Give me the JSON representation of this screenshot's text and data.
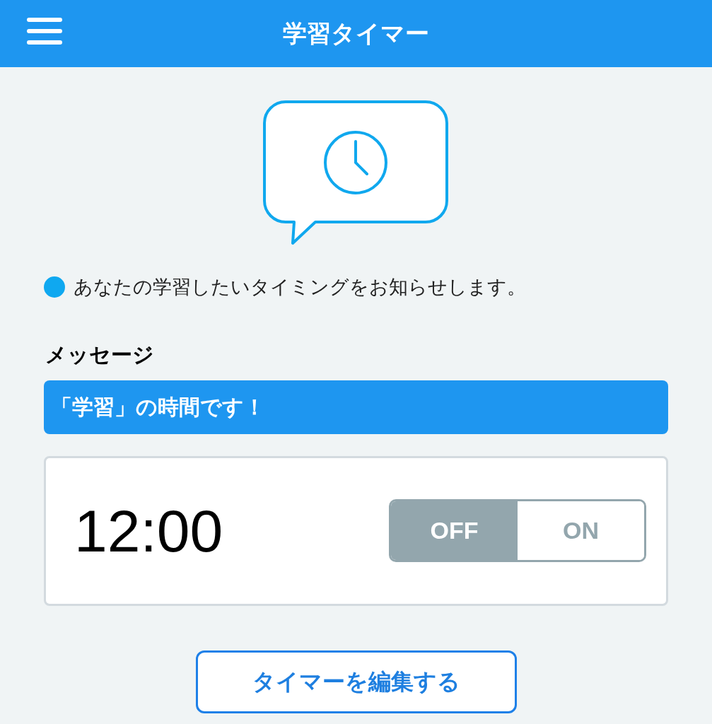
{
  "header": {
    "title": "学習タイマー"
  },
  "info": {
    "text": "あなたの学習したいタイミングをお知らせします。",
    "color": "#0fa8f0"
  },
  "message": {
    "label": "メッセージ",
    "text": "「学習」の時間です！"
  },
  "timer": {
    "time": "12:00",
    "toggle": [
      {
        "label": "OFF",
        "selected": true
      },
      {
        "label": "ON",
        "selected": false
      }
    ]
  },
  "edit_button": {
    "label": "タイマーを編集する"
  }
}
